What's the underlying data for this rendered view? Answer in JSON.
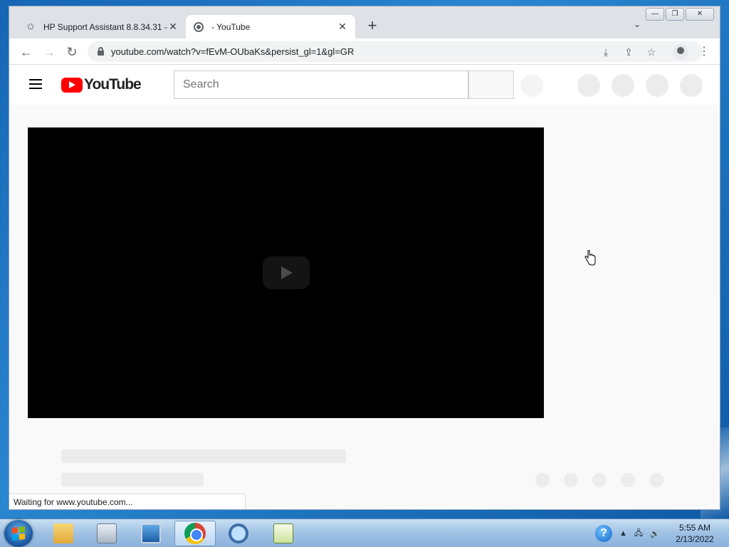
{
  "browser": {
    "tabs": [
      {
        "title": "HP Support Assistant 8.8.34.31 -",
        "icon": "hp-star-icon"
      },
      {
        "title": "- YouTube",
        "icon": "globe-icon"
      }
    ],
    "new_tab_symbol": "+",
    "tab_search_symbol": "⌄",
    "window_controls": {
      "minimize": "—",
      "restore": "❐",
      "close": "✕"
    },
    "nav": {
      "back": "←",
      "forward": "→",
      "reload": "↻"
    },
    "url": "youtube.com/watch?v=fEvM-OUbaKs&persist_gl=1&gl=GR",
    "omnibox_icons": {
      "install": "⤓",
      "share": "⇪",
      "bookmark": "☆"
    },
    "menu_symbol": "⋮",
    "status_text": "Waiting for www.youtube.com..."
  },
  "youtube": {
    "logo_text": "YouTube",
    "search_placeholder": "Search"
  },
  "taskbar": {
    "help_symbol": "?",
    "tray_arrow": "▲",
    "tray_network": "🖧",
    "tray_volume": "🔊",
    "time": "5:55 AM",
    "date": "2/13/2022"
  },
  "colors": {
    "youtube_red": "#ff0000",
    "desktop_blue": "#1f6fb8",
    "skeleton_grey": "#ececec"
  }
}
